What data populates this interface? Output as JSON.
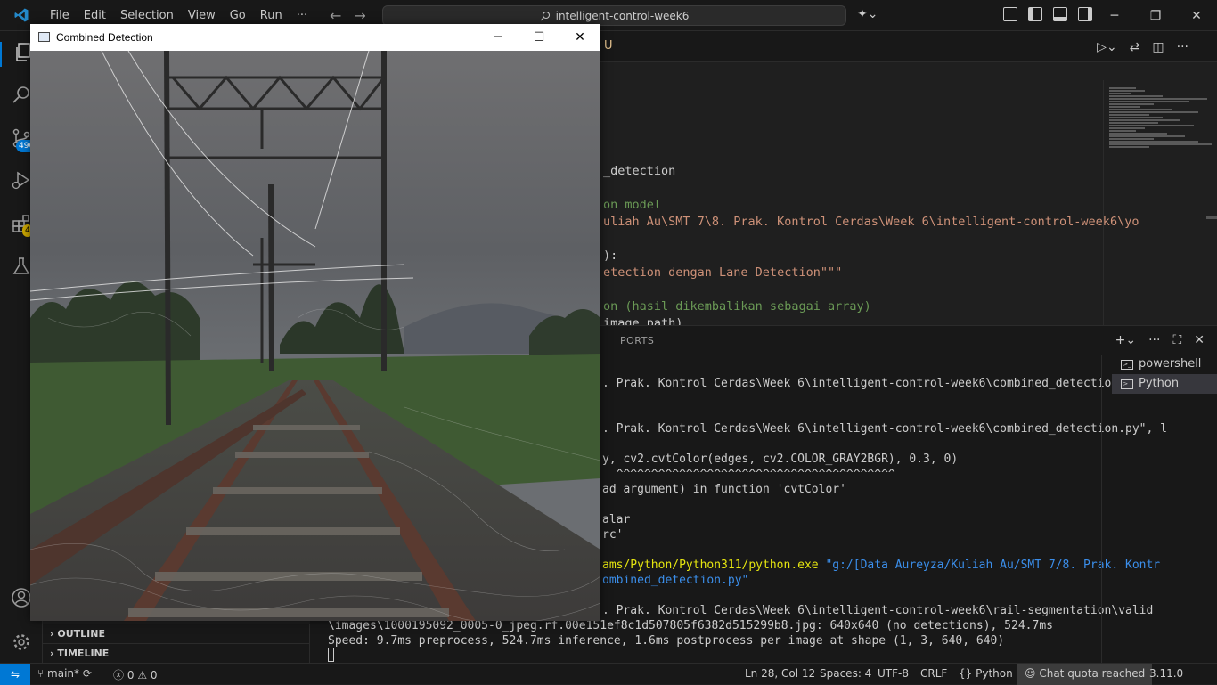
{
  "menu": [
    "File",
    "Edit",
    "Selection",
    "View",
    "Go",
    "Run",
    "···"
  ],
  "search": {
    "text": "intelligent-control-week6"
  },
  "cv_window": {
    "title": "Combined Detection"
  },
  "editor": {
    "tab_fragment": "U",
    "lines": [
      {
        "text": "_detection",
        "color": "#cccccc"
      },
      {
        "text": "on model",
        "color": "#6a9955"
      },
      {
        "text": "uliah Au\\SMT 7\\8. Prak. Kontrol Cerdas\\Week 6\\intelligent-control-week6\\yo",
        "color": "#ce9178"
      },
      {
        "text": "):",
        "color": "#cccccc"
      },
      {
        "text": "etection dengan Lane Detection\"\"\"",
        "color": "#ce9178"
      },
      {
        "text": "on (hasil dikembalikan sebagai array)",
        "color": "#6a9955"
      },
      {
        "text": "image_path)",
        "color": "#cccccc"
      }
    ]
  },
  "activity": {
    "source_control_badge": "496",
    "extensions_badge": "4"
  },
  "sidebar": {
    "outline_label": "OUTLINE",
    "timeline_label": "TIMELINE"
  },
  "panel": {
    "ports_label": "PORTS",
    "terminals": [
      "powershell",
      "Python"
    ],
    "lines": [
      {
        "text": ". Prak. Kontrol Cerdas\\Week 6\\intelligent-control-week6\\combined_detection.py\", l",
        "color": "#cccccc"
      },
      {
        "text": ". Prak. Kontrol Cerdas\\Week 6\\intelligent-control-week6\\combined_detection.py\", l",
        "color": "#cccccc"
      },
      {
        "text": "y, cv2.cvtColor(edges, cv2.COLOR_GRAY2BGR), 0.3, 0)",
        "color": "#cccccc"
      },
      {
        "text": "  ^^^^^^^^^^^^^^^^^^^^^^^^^^^^^^^^^^^^^^^^",
        "color": "#cccccc"
      },
      {
        "text": "ad argument) in function 'cvtColor'",
        "color": "#cccccc"
      },
      {
        "text": "alar",
        "color": "#cccccc"
      },
      {
        "text": "rc'",
        "color": "#cccccc"
      },
      {
        "text": "ams/Python/Python311/python.exe ",
        "color": "#e5e510",
        "extra": "\"g:/[Data Aureyza/Kuliah Au/SMT 7/8. Prak. Kontr",
        "extra_color": "#3b8eea"
      },
      {
        "text": "ombined_detection.py\"",
        "color": "#3b8eea"
      },
      {
        "text": ". Prak. Kontrol Cerdas\\Week 6\\intelligent-control-week6\\rail-segmentation\\valid",
        "color": "#cccccc"
      },
      {
        "text": "\\images\\1000195092_0005-0_jpeg.rf.00e151ef8c1d507805f6382d515299b8.jpg: 640x640 (no detections), 524.7ms",
        "color": "#cccccc"
      },
      {
        "text": "Speed: 9.7ms preprocess, 524.7ms inference, 1.6ms postprocess per image at shape (1, 3, 640, 640)",
        "color": "#cccccc"
      }
    ]
  },
  "status": {
    "branch": "main*",
    "errors": "0",
    "warnings": "0",
    "position": "Ln 28, Col 12",
    "spaces": "Spaces: 4",
    "encoding": "UTF-8",
    "eol": "CRLF",
    "language": "Python",
    "copilot": "Chat quota reached",
    "python_version": "3.11.0"
  },
  "colors": {
    "accent": "#0078d4",
    "bg": "#1f1f1f",
    "bar": "#181818"
  }
}
